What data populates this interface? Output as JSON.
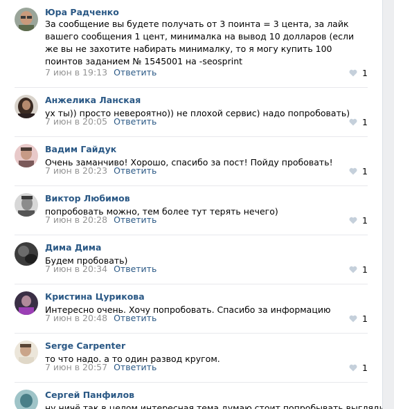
{
  "colors": {
    "author": "#2a5885",
    "meta": "#939393",
    "reply": "#2a5885",
    "heart": "#c5d0db",
    "separator": "#e7e8ec"
  },
  "comments": [
    {
      "author": "Юра Радченко",
      "text": "За сообщение вы будете получать от 3 поинта = 3 цента, за лайк вашего сообщения 1 цент, минималка на вывод 10 долларов (если же вы не захотите набирать минималку, то я могу купить 100 поинтов заданием № 1545001 на -seosprint",
      "date": "7 июн в 19:13",
      "reply": "Ответить",
      "likes": "1",
      "avatar_icon": "avatar-man-glasses"
    },
    {
      "author": "Анжелика Ланская",
      "text": "ух ты)) просто невероятно)) не плохой сервис) надо попробовать)",
      "date": "7 июн в 20:05",
      "reply": "Ответить",
      "likes": "1",
      "avatar_icon": "avatar-woman-dark"
    },
    {
      "author": "Вадим Гайдук",
      "text": "Очень заманчиво! Хорошо, спасибо за пост! Пойду пробовать!",
      "date": "7 июн в 20:23",
      "reply": "Ответить",
      "likes": "1",
      "avatar_icon": "avatar-man-pink"
    },
    {
      "author": "Виктор Любимов",
      "text": "попробовать можно, тем более тут терять нечего)",
      "date": "7 июн в 20:28",
      "reply": "Ответить",
      "likes": "1",
      "avatar_icon": "avatar-man-gray"
    },
    {
      "author": "Дима Дима",
      "text": "Будем пробовать)",
      "date": "7 июн в 20:34",
      "reply": "Ответить",
      "likes": "1",
      "avatar_icon": "avatar-dark-photo"
    },
    {
      "author": "Кристина Цурикова",
      "text": "Интересно очень. Хочу попробовать. Спасибо за информацию",
      "date": "7 июн в 20:48",
      "reply": "Ответить",
      "likes": "1",
      "avatar_icon": "avatar-purple"
    },
    {
      "author": "Serge Carpenter",
      "text": "то что надо. а то один развод кругом.",
      "date": "7 июн в 20:57",
      "reply": "Ответить",
      "likes": "1",
      "avatar_icon": "avatar-man-light"
    },
    {
      "author": "Сергей Панфилов",
      "text": "ну ничё так в целом интересная тема думаю стоит попробывать выглядит",
      "date": "",
      "reply": "",
      "likes": "",
      "avatar_icon": "avatar-teal"
    }
  ]
}
